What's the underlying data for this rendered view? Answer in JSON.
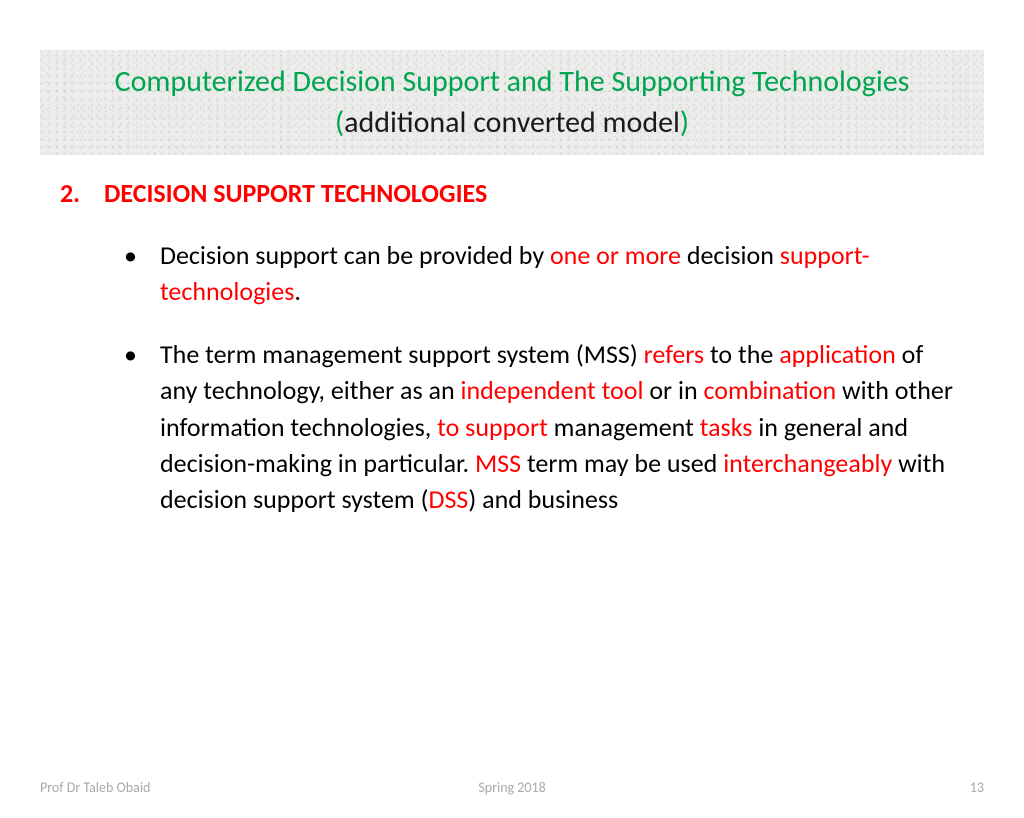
{
  "title": {
    "part1": "Computerized Decision Support and The Supporting Technologies (",
    "part2": "additional converted model",
    "part3": ")"
  },
  "section": {
    "number": "2.",
    "heading": "DECISION SUPPORT TECHNOLOGIES"
  },
  "bullets": [
    {
      "spans": [
        {
          "t": "Decision support can be provided by ",
          "c": "black"
        },
        {
          "t": "one or more",
          "c": "red"
        },
        {
          "t": " decision ",
          "c": "black"
        },
        {
          "t": "support-technologies",
          "c": "red"
        },
        {
          "t": ".",
          "c": "black"
        }
      ]
    },
    {
      "spans": [
        {
          "t": " The term management support system (MSS) ",
          "c": "black"
        },
        {
          "t": "refers",
          "c": "red"
        },
        {
          "t": " to the ",
          "c": "black"
        },
        {
          "t": "application",
          "c": "red"
        },
        {
          "t": " of any technology, either as an ",
          "c": "black"
        },
        {
          "t": "independent tool",
          "c": "red"
        },
        {
          "t": " or in ",
          "c": "black"
        },
        {
          "t": "combination",
          "c": "red"
        },
        {
          "t": " with other information technologies, ",
          "c": "black"
        },
        {
          "t": "to support",
          "c": "red"
        },
        {
          "t": " management ",
          "c": "black"
        },
        {
          "t": "tasks",
          "c": "red"
        },
        {
          "t": " in general and decision-making in particular. ",
          "c": "black"
        },
        {
          "t": "MSS",
          "c": "red"
        },
        {
          "t": " term may be used ",
          "c": "black"
        },
        {
          "t": "interchangeably",
          "c": "red"
        },
        {
          "t": " with decision support system (",
          "c": "black"
        },
        {
          "t": "DSS",
          "c": "red"
        },
        {
          "t": ") and business",
          "c": "black"
        }
      ]
    }
  ],
  "footer": {
    "left": "Prof Dr Taleb Obaid",
    "center": "Spring 2018",
    "right": "13"
  }
}
